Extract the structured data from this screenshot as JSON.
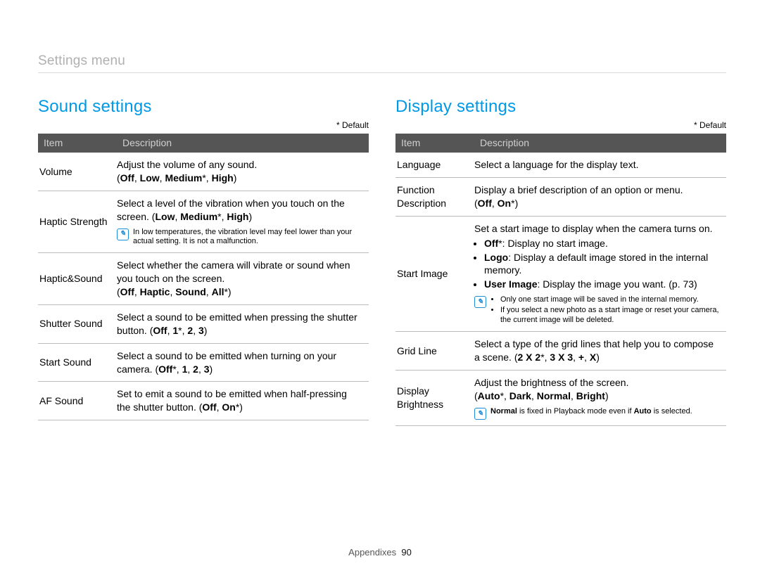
{
  "breadcrumb": "Settings menu",
  "default_note": "* Default",
  "columns": {
    "item": "Item",
    "desc": "Description"
  },
  "sound": {
    "title": "Sound settings",
    "rows": [
      {
        "item": "Volume",
        "lead": "Adjust the volume of any sound.",
        "opts_html": "(<b>Off</b>, <b>Low</b>, <b>Medium</b>*, <b>High</b>)"
      },
      {
        "item": "Haptic Strength",
        "lead": "Select a level of the vibration when you touch on the screen. (<b>Low</b>, <b>Medium</b>*, <b>High</b>)",
        "note": "In low temperatures, the vibration level may feel lower than your actual setting. It is not a malfunction."
      },
      {
        "item": "Haptic&Sound",
        "lead": "Select whether the camera will vibrate or sound when you touch on the screen.",
        "opts_html": "(<b>Off</b>, <b>Haptic</b>, <b>Sound</b>, <b>All</b>*)"
      },
      {
        "item": "Shutter Sound",
        "lead": "Select a sound to be emitted when pressing the shutter button. (<b>Off</b>, <b>1</b>*, <b>2</b>, <b>3</b>)"
      },
      {
        "item": "Start Sound",
        "lead": "Select a sound to be emitted when turning on your camera. (<b>Off</b>*, <b>1</b>, <b>2</b>, <b>3</b>)"
      },
      {
        "item": "AF Sound",
        "lead": "Set to emit a sound to be emitted when half-pressing the shutter button. (<b>Off</b>, <b>On</b>*)"
      }
    ]
  },
  "display": {
    "title": "Display settings",
    "rows": [
      {
        "item": "Language",
        "lead": "Select a language for the display text."
      },
      {
        "item": "Function Description",
        "lead": "Display a brief description of an option or menu.",
        "opts_html": "(<b>Off</b>, <b>On</b>*)"
      },
      {
        "item": "Start Image",
        "lead": "Set a start image to display when the camera turns on.",
        "bullets": [
          "<b>Off</b>*: Display no start image.",
          "<b>Logo</b>: Display a default image stored in the internal memory.",
          "<b>User Image</b>: Display the image you want. (p. 73)"
        ],
        "note_list": [
          "Only one start image will be saved in the internal memory.",
          "If you select a new photo as a start image or reset your camera, the current image will be deleted."
        ]
      },
      {
        "item": "Grid Line",
        "lead": "Select a type of the grid lines that help you to compose a scene. (<b>2 X 2</b>*, <b>3 X 3</b>, <b>+</b>, <b>X</b>)"
      },
      {
        "item": "Display Brightness",
        "lead": "Adjust the brightness of the screen.",
        "opts_html": "(<b>Auto</b>*, <b>Dark</b>, <b>Normal</b>, <b>Bright</b>)",
        "note_html": "<b>Normal</b> is fixed in Playback mode even if <b>Auto</b> is selected."
      }
    ]
  },
  "footer": {
    "section": "Appendixes",
    "page": "90"
  },
  "note_icon_glyph": "✎"
}
